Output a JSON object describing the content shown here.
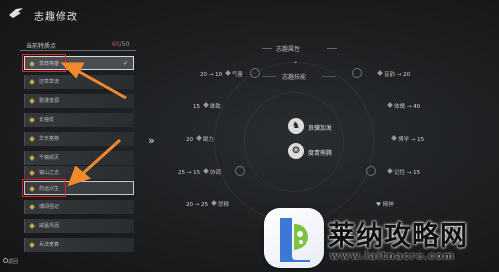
{
  "header": {
    "title": "志趣修改"
  },
  "left_panel": {
    "title": "当前特质点",
    "count_current": "60",
    "count_total": "/50",
    "traits": [
      {
        "label": "草莽英雄",
        "selected": true
      },
      {
        "label": "还草草流"
      },
      {
        "label": "勤谨逢源"
      },
      {
        "label": "长袖仗"
      },
      {
        "label": "华天格物"
      },
      {
        "label": "千蜿顽灭"
      },
      {
        "label": "镇山之志"
      },
      {
        "label": "药运兴生",
        "highlight": true
      },
      {
        "label": "博闻强记"
      },
      {
        "label": "威猛巩固"
      },
      {
        "label": "兵法奇算"
      }
    ]
  },
  "center": {
    "attr_tab": "志趣属性",
    "skill_tab": "志趣技能",
    "skills": [
      {
        "label": "良骥加发",
        "icon": "horse-icon"
      },
      {
        "label": "度青熊腾",
        "icon": "bear-icon"
      }
    ]
  },
  "stats": [
    {
      "name": "气量",
      "from": "20",
      "to": "10"
    },
    {
      "name": "维致",
      "value": "15"
    },
    {
      "name": "眼力",
      "value": "20"
    },
    {
      "name": "协调",
      "from": "25",
      "to": "15"
    },
    {
      "name": "悲精",
      "from": "20",
      "to": "25"
    },
    {
      "name": "音韵",
      "value": "20"
    },
    {
      "name": "体魄",
      "value": "40"
    },
    {
      "name": "博学",
      "value": "15"
    },
    {
      "name": "记性",
      "value": "15"
    },
    {
      "name": "精神",
      "value": ""
    }
  ],
  "footer": {
    "hint": "返回"
  },
  "watermark": {
    "title": "莱纳攻略网",
    "url": "www.laitnacre.com"
  },
  "colors": {
    "accent_red": "#e0282c",
    "count_red": "#d35454",
    "arrow_orange": "#f08a2c"
  }
}
